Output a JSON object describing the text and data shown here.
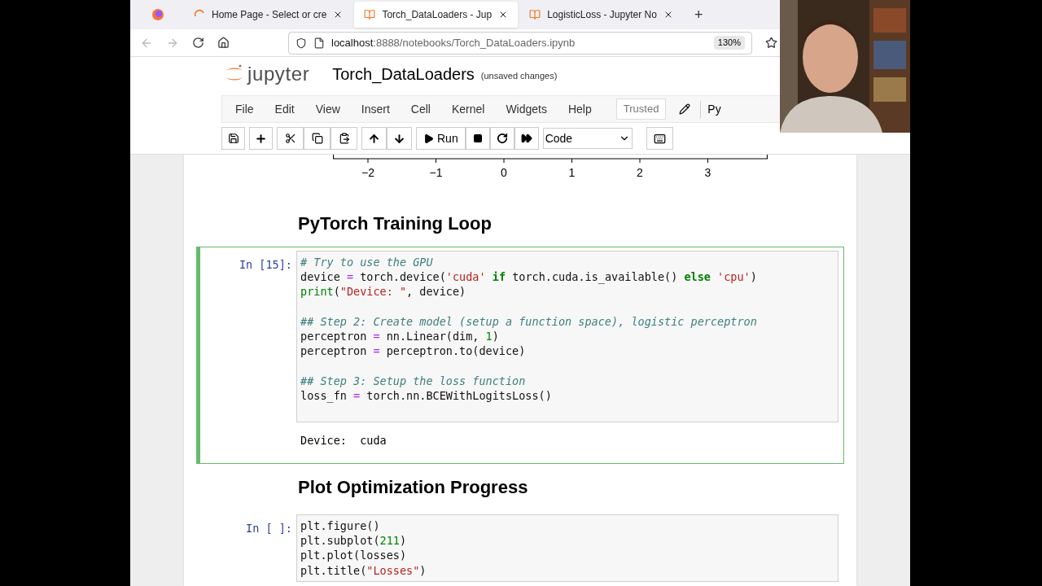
{
  "browser": {
    "tabs": [
      {
        "kind": "firefox",
        "selected": false
      },
      {
        "kind": "home",
        "title": "Home Page - Select or cre",
        "selected": false
      },
      {
        "kind": "notebook",
        "title": "Torch_DataLoaders - Jup",
        "selected": true
      },
      {
        "kind": "notebook",
        "title": "LogisticLoss - Jupyter No",
        "selected": false
      }
    ],
    "new_tab": "+",
    "url_host": "localhost",
    "url_rest": ":8888/notebooks/Torch_DataLoaders.ipynb",
    "zoom": "130%"
  },
  "jupyter": {
    "logo": "jupyter",
    "notebook_name": "Torch_DataLoaders",
    "status": "(unsaved changes)",
    "menu": [
      "File",
      "Edit",
      "View",
      "Insert",
      "Cell",
      "Kernel",
      "Widgets",
      "Help"
    ],
    "trusted": "Trusted",
    "kernel": "Py",
    "run_label": "Run",
    "cell_type": "Code"
  },
  "notebook": {
    "axis_ticks": [
      "−2",
      "−1",
      "0",
      "1",
      "2",
      "3"
    ],
    "cells": [
      {
        "kind": "heading",
        "text": "PyTorch Training Loop"
      },
      {
        "kind": "code",
        "prompt": "In [15]:",
        "selected": true,
        "lines": [
          {
            "kind": "code",
            "tokens": [
              {
                "kind": "comment",
                "s": "# Try to use the GPU"
              }
            ]
          },
          {
            "kind": "code",
            "tokens": [
              {
                "kind": "plain",
                "s": "device "
              },
              {
                "kind": "op",
                "s": "="
              },
              {
                "kind": "plain",
                "s": " torch.device("
              },
              {
                "kind": "string",
                "s": "'cuda'"
              },
              {
                "kind": "keyword",
                "s": " if"
              },
              {
                "kind": "plain",
                "s": " torch.cuda.is_available() "
              },
              {
                "kind": "keyword",
                "s": "else"
              },
              {
                "kind": "string",
                "s": " 'cpu'"
              },
              {
                "kind": "plain",
                "s": ")"
              }
            ]
          },
          {
            "kind": "code",
            "tokens": [
              {
                "kind": "builtin",
                "s": "print"
              },
              {
                "kind": "plain",
                "s": "("
              },
              {
                "kind": "string",
                "s": "\"Device: \""
              },
              {
                "kind": "plain",
                "s": ", device)"
              }
            ]
          },
          {
            "kind": "blank"
          },
          {
            "kind": "code",
            "tokens": [
              {
                "kind": "comment",
                "s": "## Step 2: Create model (setup a function space), logistic perceptron"
              }
            ]
          },
          {
            "kind": "code",
            "tokens": [
              {
                "kind": "plain",
                "s": "perceptron "
              },
              {
                "kind": "op",
                "s": "="
              },
              {
                "kind": "plain",
                "s": " nn.Linear(dim, "
              },
              {
                "kind": "number",
                "s": "1"
              },
              {
                "kind": "plain",
                "s": ")"
              }
            ]
          },
          {
            "kind": "code",
            "tokens": [
              {
                "kind": "plain",
                "s": "perceptron "
              },
              {
                "kind": "op",
                "s": "="
              },
              {
                "kind": "plain",
                "s": " perceptron.to(device)"
              }
            ]
          },
          {
            "kind": "blank"
          },
          {
            "kind": "code",
            "tokens": [
              {
                "kind": "comment",
                "s": "## Step 3: Setup the loss function"
              }
            ]
          },
          {
            "kind": "code",
            "tokens": [
              {
                "kind": "plain",
                "s": "loss_fn "
              },
              {
                "kind": "op",
                "s": "="
              },
              {
                "kind": "plain",
                "s": " torch.nn.BCEWithLogitsLoss()"
              }
            ]
          },
          {
            "kind": "blank"
          }
        ],
        "output": "Device:  cuda"
      },
      {
        "kind": "heading",
        "text": "Plot Optimization Progress"
      },
      {
        "kind": "code",
        "prompt": "In [ ]:",
        "selected": false,
        "lines": [
          {
            "kind": "code",
            "tokens": [
              {
                "kind": "plain",
                "s": "plt.figure()"
              }
            ]
          },
          {
            "kind": "code",
            "tokens": [
              {
                "kind": "plain",
                "s": "plt.subplot("
              },
              {
                "kind": "number",
                "s": "211"
              },
              {
                "kind": "plain",
                "s": ")"
              }
            ]
          },
          {
            "kind": "code",
            "tokens": [
              {
                "kind": "plain",
                "s": "plt.plot(losses)"
              }
            ]
          },
          {
            "kind": "code",
            "tokens": [
              {
                "kind": "plain",
                "s": "plt.title("
              },
              {
                "kind": "string",
                "s": "\"Losses\""
              },
              {
                "kind": "plain",
                "s": ")"
              }
            ]
          }
        ]
      }
    ]
  }
}
